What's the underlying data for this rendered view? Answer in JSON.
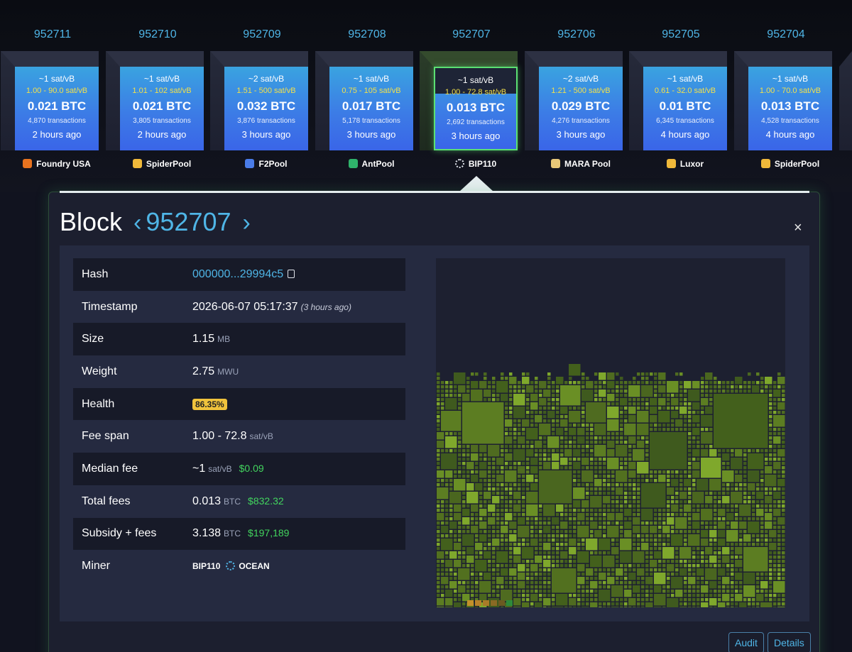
{
  "blocks": [
    {
      "height": "952711",
      "fee": "~1 sat/vB",
      "span": "1.00 - 90.0 sat/vB",
      "total": "0.021 BTC",
      "txs": "4,870 transactions",
      "ago": "2 hours ago",
      "pool": "Foundry USA",
      "pool_icon": "foundry-icon",
      "pool_color": "#e8731f",
      "selected": false
    },
    {
      "height": "952710",
      "fee": "~1 sat/vB",
      "span": "1.01 - 102 sat/vB",
      "total": "0.021 BTC",
      "txs": "3,805 transactions",
      "ago": "2 hours ago",
      "pool": "SpiderPool",
      "pool_icon": "spiderpool-icon",
      "pool_color": "#f0b93a",
      "selected": false
    },
    {
      "height": "952709",
      "fee": "~2 sat/vB",
      "span": "1.51 - 500 sat/vB",
      "total": "0.032 BTC",
      "txs": "3,876 transactions",
      "ago": "3 hours ago",
      "pool": "F2Pool",
      "pool_icon": "f2pool-icon",
      "pool_color": "#4a7ce8",
      "selected": false
    },
    {
      "height": "952708",
      "fee": "~1 sat/vB",
      "span": "0.75 - 105 sat/vB",
      "total": "0.017 BTC",
      "txs": "5,178 transactions",
      "ago": "3 hours ago",
      "pool": "AntPool",
      "pool_icon": "antpool-icon",
      "pool_color": "#2fb36b",
      "selected": false
    },
    {
      "height": "952707",
      "fee": "~1 sat/vB",
      "span": "1.00 - 72.8 sat/vB",
      "total": "0.013 BTC",
      "txs": "2,692 transactions",
      "ago": "3 hours ago",
      "pool": "BIP110",
      "pool_icon": "ocean-icon",
      "pool_color": "#dfe3ea",
      "selected": true
    },
    {
      "height": "952706",
      "fee": "~2 sat/vB",
      "span": "1.21 - 500 sat/vB",
      "total": "0.029 BTC",
      "txs": "4,276 transactions",
      "ago": "3 hours ago",
      "pool": "MARA Pool",
      "pool_icon": "mara-icon",
      "pool_color": "#e8c878",
      "selected": false
    },
    {
      "height": "952705",
      "fee": "~1 sat/vB",
      "span": "0.61 - 32.0 sat/vB",
      "total": "0.01 BTC",
      "txs": "6,345 transactions",
      "ago": "4 hours ago",
      "pool": "Luxor",
      "pool_icon": "luxor-icon",
      "pool_color": "#f0b93a",
      "selected": false
    },
    {
      "height": "952704",
      "fee": "~1 sat/vB",
      "span": "1.00 - 70.0 sat/vB",
      "total": "0.013 BTC",
      "txs": "4,528 transactions",
      "ago": "4 hours ago",
      "pool": "SpiderPool",
      "pool_icon": "spiderpool-icon",
      "pool_color": "#f0b93a",
      "selected": false
    }
  ],
  "details": {
    "title": "Block",
    "prev_chevron": "‹",
    "next_chevron": "›",
    "height": "952707",
    "close": "×",
    "rows": {
      "hash_label": "Hash",
      "hash_value": "000000...29994c5",
      "timestamp_label": "Timestamp",
      "timestamp_value": "2026-06-07 05:17:37",
      "timestamp_ago": "(3 hours ago)",
      "size_label": "Size",
      "size_value": "1.15",
      "size_unit": "MB",
      "weight_label": "Weight",
      "weight_value": "2.75",
      "weight_unit": "MWU",
      "health_label": "Health",
      "health_value": "86.35%",
      "feespan_label": "Fee span",
      "feespan_value": "1.00 - 72.8",
      "feespan_unit": "sat/vB",
      "median_label": "Median fee",
      "median_value": "~1",
      "median_unit": "sat/vB",
      "median_usd": "$0.09",
      "totalfees_label": "Total fees",
      "totalfees_value": "0.013",
      "totalfees_unit": "BTC",
      "totalfees_usd": "$832.32",
      "subsidy_label": "Subsidy + fees",
      "subsidy_value": "3.138",
      "subsidy_unit": "BTC",
      "subsidy_usd": "$197,189",
      "miner_label": "Miner",
      "miner_tag": "BIP110",
      "miner_pool": "OCEAN"
    }
  },
  "buttons": {
    "audit": "Audit",
    "details": "Details"
  },
  "colors": {
    "accent": "#4fb5e6",
    "usd": "#42d45e",
    "health": "#f0c33c",
    "selected_border": "#5be073"
  }
}
